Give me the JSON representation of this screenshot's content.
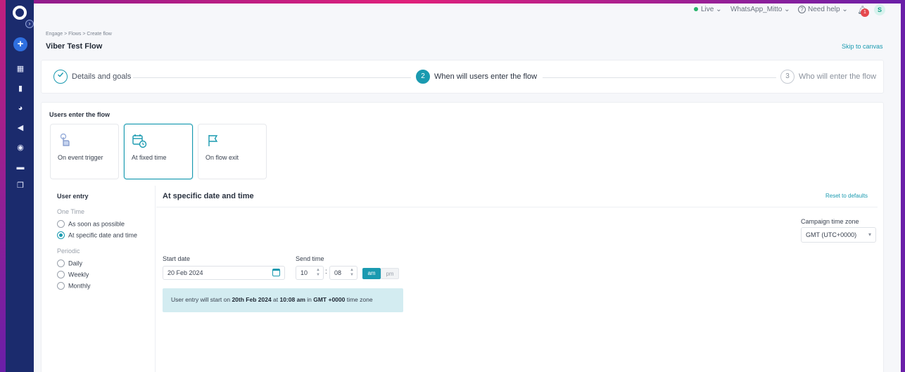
{
  "topbar": {
    "live": "Live",
    "account": "WhatsApp_Mitto",
    "help": "Need help",
    "notification_count": "1",
    "avatar_initial": "S"
  },
  "breadcrumb": "Engage > Flows > Create flow",
  "page_title": "Viber Test Flow",
  "skip_to_canvas": "Skip to canvas",
  "stepper": {
    "steps": [
      {
        "number": "",
        "label": "Details and goals",
        "state": "done"
      },
      {
        "number": "2",
        "label": "When will users enter the flow",
        "state": "active"
      },
      {
        "number": "3",
        "label": "Who will enter the flow",
        "state": "pending"
      }
    ]
  },
  "panel": {
    "heading": "Users enter the flow",
    "cards": [
      {
        "label": "On event trigger",
        "icon": "tap-icon",
        "selected": false
      },
      {
        "label": "At fixed time",
        "icon": "calendar-clock-icon",
        "selected": true
      },
      {
        "label": "On flow exit",
        "icon": "flag-icon",
        "selected": false
      }
    ]
  },
  "entry": {
    "header": "User entry",
    "one_time_label": "One Time",
    "one_time_options": [
      "As soon as possible",
      "At specific date and time"
    ],
    "periodic_label": "Periodic",
    "periodic_options": [
      "Daily",
      "Weekly",
      "Monthly"
    ],
    "selected": "At specific date and time"
  },
  "content": {
    "title": "At specific date and time",
    "reset": "Reset to defaults",
    "timezone_label": "Campaign time zone",
    "timezone_value": "GMT (UTC+0000)",
    "start_date_label": "Start date",
    "start_date_value": "20 Feb 2024",
    "send_time_label": "Send time",
    "hour": "10",
    "minute": "08",
    "am": "am",
    "pm": "pm",
    "info_prefix": "User entry will start on ",
    "info_date": "20th Feb 2024",
    "info_at": " at ",
    "info_time": "10:08 am",
    "info_in": " in ",
    "info_tz": "GMT +0000",
    "info_suffix": " time zone"
  },
  "colors": {
    "accent": "#1a9ab0",
    "sidebar": "#1b2b6d",
    "frame": "#e0207a"
  }
}
